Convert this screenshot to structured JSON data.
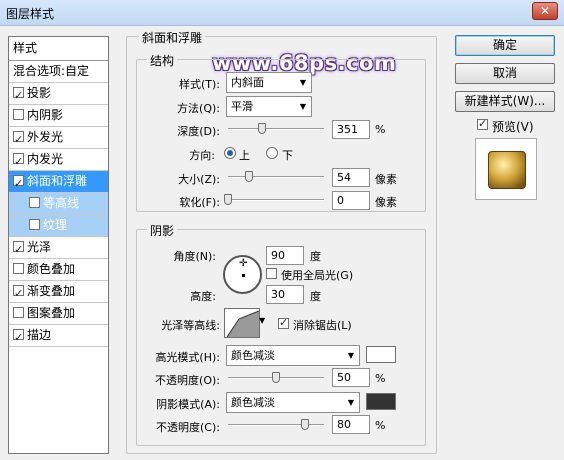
{
  "window": {
    "title": "图层样式",
    "close_glyph": "✕"
  },
  "watermark": "www.68ps.com",
  "stylelist": {
    "header": "样式",
    "blend": "混合选项:自定",
    "items": [
      {
        "label": "投影",
        "checked": true
      },
      {
        "label": "内阴影",
        "checked": false
      },
      {
        "label": "外发光",
        "checked": true
      },
      {
        "label": "内发光",
        "checked": true
      },
      {
        "label": "斜面和浮雕",
        "checked": true,
        "selected": true
      },
      {
        "label": "等高线",
        "checked": false,
        "sub": true
      },
      {
        "label": "纹理",
        "checked": false,
        "sub": true
      },
      {
        "label": "光泽",
        "checked": true
      },
      {
        "label": "颜色叠加",
        "checked": false
      },
      {
        "label": "渐变叠加",
        "checked": true
      },
      {
        "label": "图案叠加",
        "checked": false
      },
      {
        "label": "描边",
        "checked": true
      }
    ]
  },
  "bevel": {
    "title": "斜面和浮雕",
    "structure": {
      "title": "结构",
      "style_label": "样式(T):",
      "style_value": "内斜面",
      "technique_label": "方法(Q):",
      "technique_value": "平滑",
      "depth_label": "深度(D):",
      "depth_value": "351",
      "depth_unit": "%",
      "depth_slider": 0.35,
      "direction_label": "方向:",
      "dir_up": "上",
      "dir_down": "下",
      "direction_selected": "上",
      "size_label": "大小(Z):",
      "size_value": "54",
      "size_unit": "像素",
      "size_slider": 0.22,
      "soften_label": "软化(F):",
      "soften_value": "0",
      "soften_unit": "像素",
      "soften_slider": 0.0
    },
    "shading": {
      "title": "阴影",
      "angle_label": "角度(N):",
      "angle_value": "90",
      "angle_unit": "度",
      "global_light_label": "使用全局光(G)",
      "global_light_checked": false,
      "altitude_label": "高度:",
      "altitude_value": "30",
      "altitude_unit": "度",
      "gloss_label": "光泽等高线:",
      "antialias_label": "消除锯齿(L)",
      "antialias_checked": true,
      "highlight_mode_label": "高光模式(H):",
      "highlight_mode_value": "颜色减淡",
      "highlight_color": "#ffffff",
      "highlight_opacity_label": "不透明度(O):",
      "highlight_opacity_value": "50",
      "highlight_opacity_unit": "%",
      "highlight_opacity": 0.5,
      "shadow_mode_label": "阴影模式(A):",
      "shadow_mode_value": "颜色减淡",
      "shadow_color": "#333333",
      "shadow_opacity_label": "不透明度(C):",
      "shadow_opacity_value": "80",
      "shadow_opacity_unit": "%",
      "shadow_opacity": 0.8
    }
  },
  "buttons": {
    "ok": "确定",
    "cancel": "取消",
    "new_style": "新建样式(W)...",
    "preview": "预览(V)",
    "preview_checked": true
  },
  "colors": {
    "selection": "#3399ff",
    "sub_selection": "#a7d0f7"
  }
}
